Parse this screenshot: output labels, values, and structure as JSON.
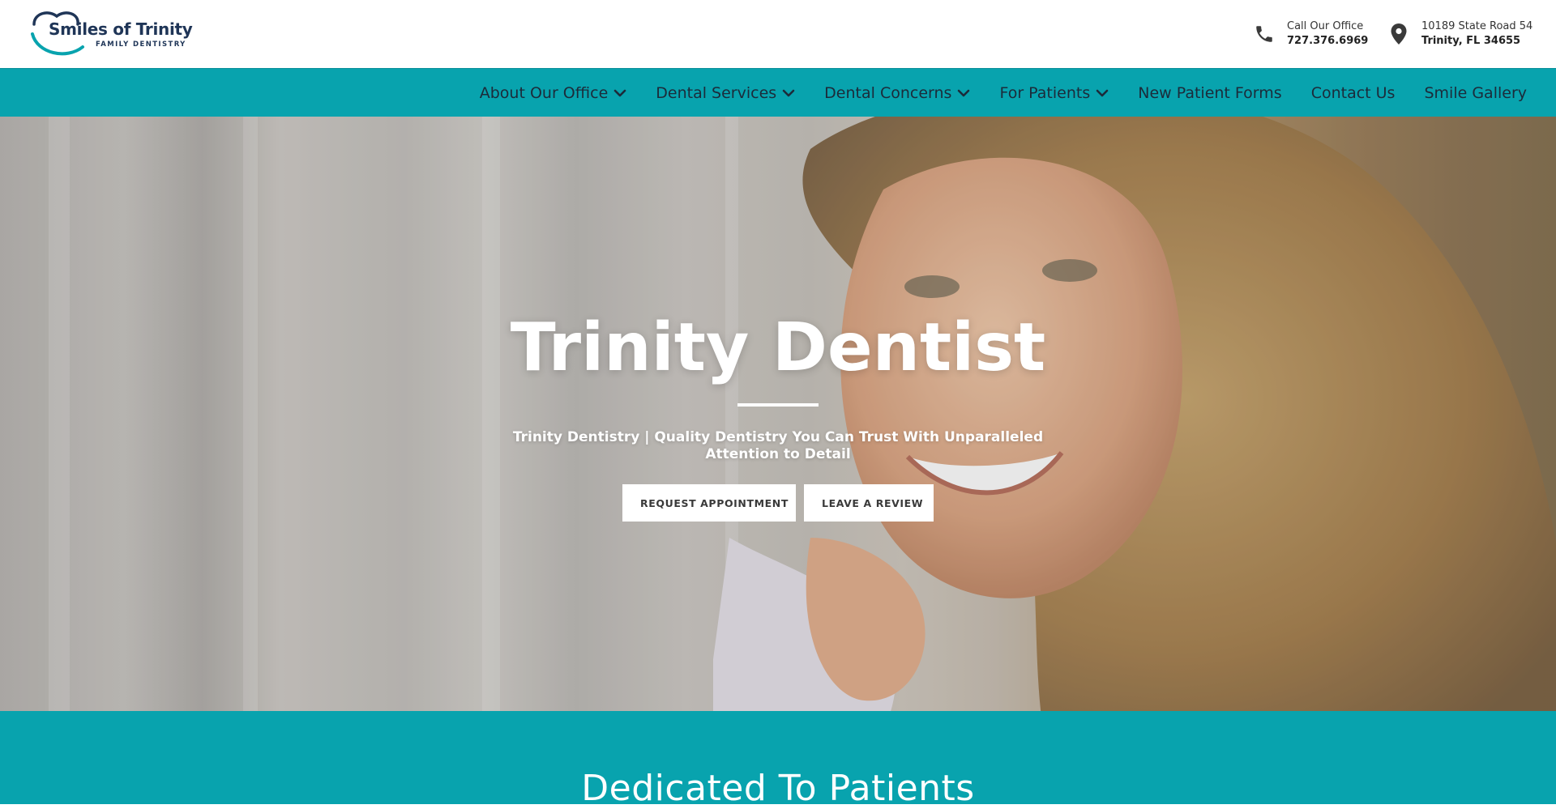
{
  "brand": {
    "name": "Smiles of Trinity",
    "tagline": "FAMILY DENTISTRY",
    "colors": {
      "primary_teal": "#08a3ae",
      "navy": "#1f3557"
    }
  },
  "header": {
    "phone": {
      "icon": "phone-icon",
      "label": "Call Our Office",
      "value": "727.376.6969"
    },
    "address": {
      "icon": "map-pin-icon",
      "line1": "10189 State Road 54",
      "line2": "Trinity, FL 34655"
    }
  },
  "nav": {
    "items": [
      {
        "label": "About Our Office",
        "dropdown": true
      },
      {
        "label": "Dental Services",
        "dropdown": true
      },
      {
        "label": "Dental Concerns",
        "dropdown": true
      },
      {
        "label": "For Patients",
        "dropdown": true
      },
      {
        "label": "New Patient Forms",
        "dropdown": false
      },
      {
        "label": "Contact Us",
        "dropdown": false
      },
      {
        "label": "Smile Gallery",
        "dropdown": false
      }
    ]
  },
  "hero": {
    "title": "Trinity Dentist",
    "subtitle": "Trinity Dentistry | Quality Dentistry You Can Trust With Unparalleled Attention to Detail",
    "buttons": {
      "appointment": "REQUEST APPOINTMENT",
      "review": "LEAVE A REVIEW"
    }
  },
  "section": {
    "title": "Dedicated To Patients"
  }
}
